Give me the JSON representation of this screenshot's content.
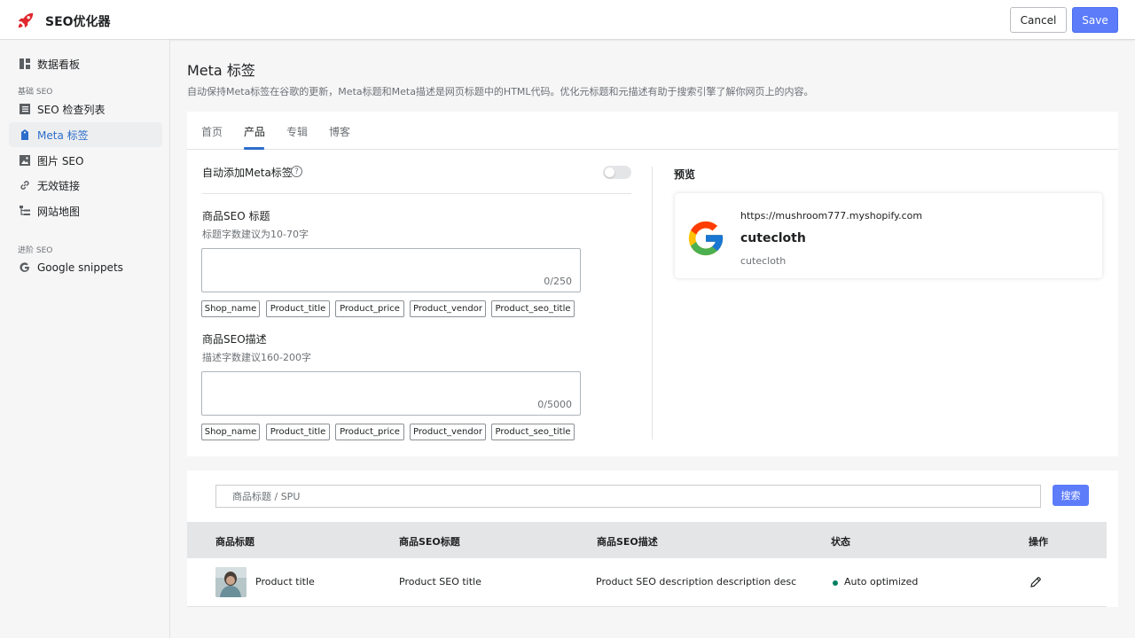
{
  "app": {
    "title": "SEO优化器"
  },
  "header": {
    "cancel_label": "Cancel",
    "save_label": "Save"
  },
  "sidebar": {
    "items": [
      {
        "label": "数据看板",
        "icon": "dashboard-icon"
      },
      {
        "label": "SEO 检查列表",
        "icon": "list-icon"
      },
      {
        "label": "Meta 标签",
        "icon": "tag-icon"
      },
      {
        "label": "图片 SEO",
        "icon": "image-icon"
      },
      {
        "label": "无效链接",
        "icon": "link-icon"
      },
      {
        "label": "网站地图",
        "icon": "sitemap-icon"
      },
      {
        "label": "Google snippets",
        "icon": "google-icon"
      }
    ],
    "sections": {
      "basic": "基础 SEO",
      "advanced": "进阶 SEO"
    },
    "active_item": "Meta 标签"
  },
  "page": {
    "title": "Meta 标签",
    "description": "自动保持Meta标签在谷歌的更新，Meta标题和Meta描述是网页标题中的HTML代码。优化元标题和元描述有助于搜索引擎了解你网页上的内容。"
  },
  "tabs": [
    {
      "label": "首页"
    },
    {
      "label": "产品"
    },
    {
      "label": "专辑"
    },
    {
      "label": "博客"
    }
  ],
  "active_tab": "产品",
  "auto_meta": {
    "label": "自动添加Meta标签",
    "help": "?",
    "enabled": false
  },
  "seo_title": {
    "label": "商品SEO 标题",
    "hint": "标题字数建议为10-70字",
    "value": "",
    "counter": "0/250"
  },
  "seo_desc": {
    "label": "商品SEO描述",
    "hint": "描述字数建议160-200字",
    "value": "",
    "counter": "0/5000"
  },
  "variables": [
    "Shop_name",
    "Product_title",
    "Product_price",
    "Product_vendor",
    "Product_seo_title"
  ],
  "preview": {
    "title": "预览",
    "url": "https://mushroom777.myshopify.com",
    "heading": "cutecloth",
    "description": "cutecloth"
  },
  "search": {
    "placeholder": "商品标题 / SPU",
    "button_label": "搜索"
  },
  "table": {
    "columns": [
      "商品标题",
      "商品SEO标题",
      "商品SEO描述",
      "状态",
      "操作"
    ],
    "rows": [
      {
        "title": "Product title",
        "seo_title": "Product SEO title",
        "seo_desc": "Product SEO description description desc",
        "status": "Auto optimized",
        "status_color": "#008060"
      }
    ]
  },
  "colors": {
    "primary": "#5c7cfa",
    "active_nav": "#2c6ecb",
    "status_ok": "#008060"
  }
}
